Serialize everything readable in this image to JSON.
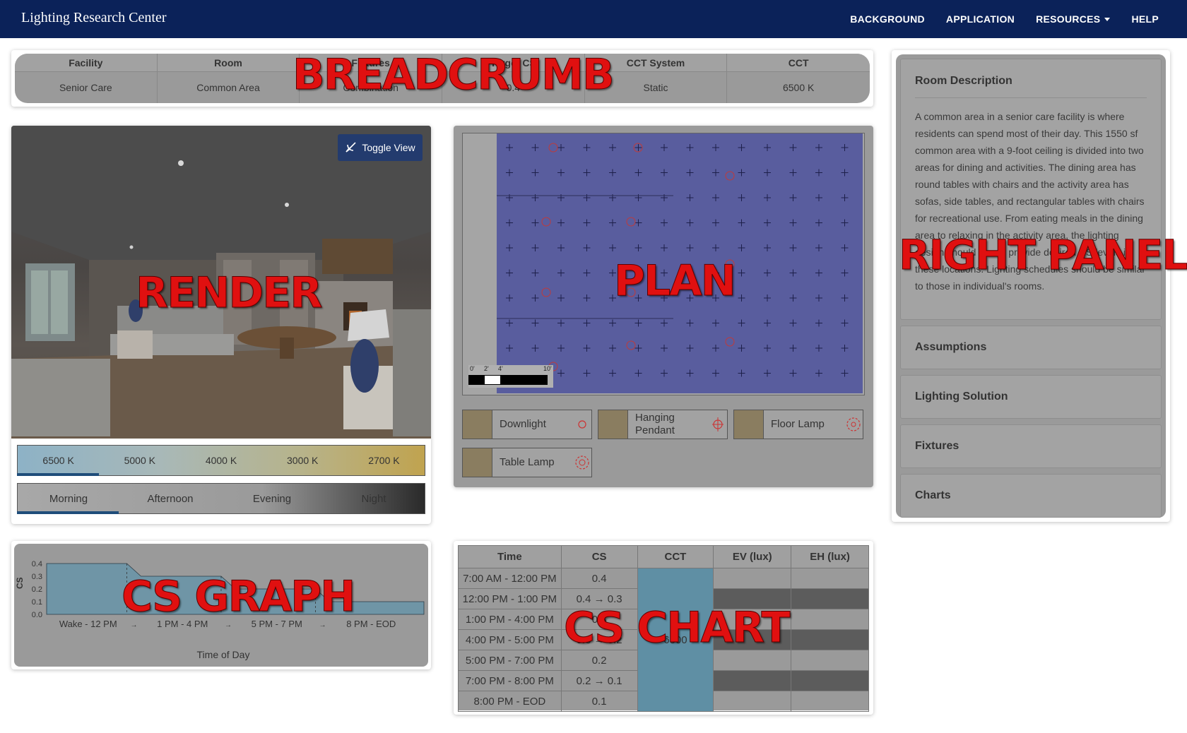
{
  "navbar": {
    "brand": "Lighting Research Center",
    "links": [
      "BACKGROUND",
      "APPLICATION",
      "RESOURCES",
      "HELP"
    ]
  },
  "breadcrumb": {
    "label": "BREADCRUMB",
    "headers": [
      "Facility",
      "Room",
      "Fixtures",
      "Target CS",
      "CCT System",
      "CCT"
    ],
    "values": [
      "Senior Care",
      "Common Area",
      "Combination",
      "0.4",
      "Static",
      "6500 K"
    ]
  },
  "render": {
    "label": "RENDER",
    "toggle_view": "Toggle View",
    "cct_options": [
      "6500 K",
      "5000 K",
      "4000 K",
      "3000 K",
      "2700 K"
    ],
    "selected_cct": "6500 K",
    "time_options": [
      "Morning",
      "Afternoon",
      "Evening",
      "Night"
    ],
    "selected_time": "Morning"
  },
  "plan": {
    "label": "PLAN",
    "scale_labels": [
      "0'",
      "2'",
      "4'",
      "10'"
    ],
    "legend": [
      {
        "label": "Downlight",
        "icon": "downlight-symbol-icon"
      },
      {
        "label": "Hanging Pendant",
        "icon": "pendant-symbol-icon"
      },
      {
        "label": "Floor Lamp",
        "icon": "floor-lamp-symbol-icon"
      },
      {
        "label": "Table Lamp",
        "icon": "table-lamp-symbol-icon"
      }
    ]
  },
  "right_panel": {
    "label": "RIGHT PANEL",
    "room_description_title": "Room Description",
    "room_description_text": "A common area in a senior care facility is where residents can spend most of their day. This 1550 sf common area with a 9-foot ceiling is divided into two areas for dining and activities. The dining area has round tables with chairs and the activity area has sofas, side tables, and rectangular tables with chairs for recreational use. From eating meals in the dining area to relaxing in the activity area, the lighting design should aim to provide desired CS levels in these locations. Lighting schedules should be similar to those in individual's rooms.",
    "sections": [
      "Assumptions",
      "Lighting Solution",
      "Fixtures",
      "Charts"
    ]
  },
  "cs_graph": {
    "label": "CS GRAPH",
    "ylabel": "CS",
    "xlabel": "Time of Day",
    "y_ticks": [
      "0.4",
      "0.3",
      "0.2",
      "0.1",
      "0.0"
    ],
    "x_labels": [
      "Wake - 12 PM",
      "1 PM - 4 PM",
      "5 PM - 7 PM",
      "8 PM - EOD"
    ],
    "fill_color": "#6f95a6"
  },
  "chart_data": {
    "type": "area",
    "title": "",
    "xlabel": "Time of Day",
    "ylabel": "CS",
    "categories": [
      "Wake - 12 PM",
      "1 PM - 4 PM",
      "5 PM - 7 PM",
      "8 PM - EOD"
    ],
    "values": [
      0.4,
      0.3,
      0.2,
      0.1
    ],
    "ylim": [
      0,
      0.4
    ]
  },
  "cs_chart": {
    "label": "CS CHART",
    "headers": [
      "Time",
      "CS",
      "CCT",
      "EV (lux)",
      "EH (lux)"
    ],
    "rows": [
      {
        "time": "7:00 AM - 12:00 PM",
        "cs": "0.4"
      },
      {
        "time": "12:00 PM - 1:00 PM",
        "cs": "0.4 → 0.3"
      },
      {
        "time": "1:00 PM - 4:00 PM",
        "cs": "0.3"
      },
      {
        "time": "4:00 PM - 5:00 PM",
        "cs": "0.3 → 0.2"
      },
      {
        "time": "5:00 PM - 7:00 PM",
        "cs": "0.2"
      },
      {
        "time": "7:00 PM - 8:00 PM",
        "cs": "0.2 → 0.1"
      },
      {
        "time": "8:00 PM - EOD",
        "cs": "0.1"
      }
    ],
    "cct_value": "6500",
    "cct_color": "#5f8fa4"
  }
}
